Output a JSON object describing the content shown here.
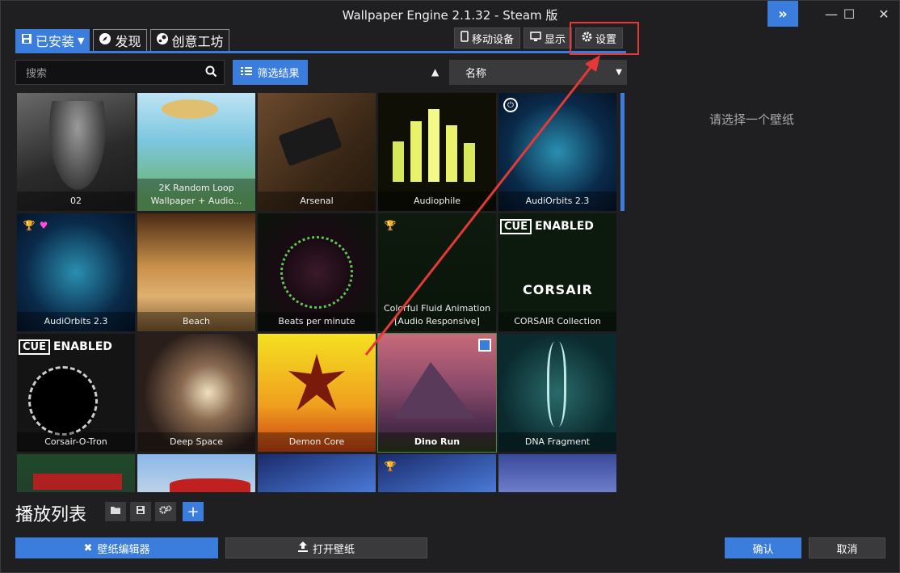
{
  "window": {
    "title": "Wallpaper Engine 2.1.32 - Steam 版",
    "expand_icon": "»",
    "minimize_icon": "—",
    "maximize_icon": "☐",
    "close_icon": "✕"
  },
  "tabs": [
    {
      "label": "已安装",
      "icon": "save-icon",
      "active": true
    },
    {
      "label": "发现",
      "icon": "compass-icon",
      "active": false
    },
    {
      "label": "创意工坊",
      "icon": "steam-icon",
      "active": false
    }
  ],
  "top_actions": {
    "mobile": "移动设备",
    "display": "显示",
    "settings": "设置"
  },
  "search": {
    "placeholder": "搜索"
  },
  "filter": {
    "label": "筛选结果"
  },
  "sort": {
    "selected": "名称"
  },
  "wallpapers": [
    {
      "title": "02"
    },
    {
      "title": "2K Random Loop Wallpaper + Audio..."
    },
    {
      "title": "Arsenal"
    },
    {
      "title": "Audiophile"
    },
    {
      "title": "AudiOrbits 2.3"
    },
    {
      "title": "AudiOrbits 2.3"
    },
    {
      "title": "Beach"
    },
    {
      "title": "Beats per minute"
    },
    {
      "title": "Colorful Fluid Animation [Audio Responsive]"
    },
    {
      "title": "CORSAIR Collection"
    },
    {
      "title": "Corsair-O-Tron"
    },
    {
      "title": "Deep Space"
    },
    {
      "title": "Demon Core"
    },
    {
      "title": "Dino Run"
    },
    {
      "title": "DNA Fragment"
    }
  ],
  "cue_label": "CUE",
  "cue_enabled": "ENABLED",
  "corsair_label": "CORSAIR",
  "right_panel": {
    "placeholder": "请选择一个壁纸"
  },
  "playlist": {
    "title": "播放列表"
  },
  "bottom": {
    "editor": "壁纸编辑器",
    "open": "打开壁纸",
    "ok": "确认",
    "cancel": "取消"
  },
  "colors": {
    "accent": "#3b7ddd",
    "annotation": "#e53935"
  }
}
